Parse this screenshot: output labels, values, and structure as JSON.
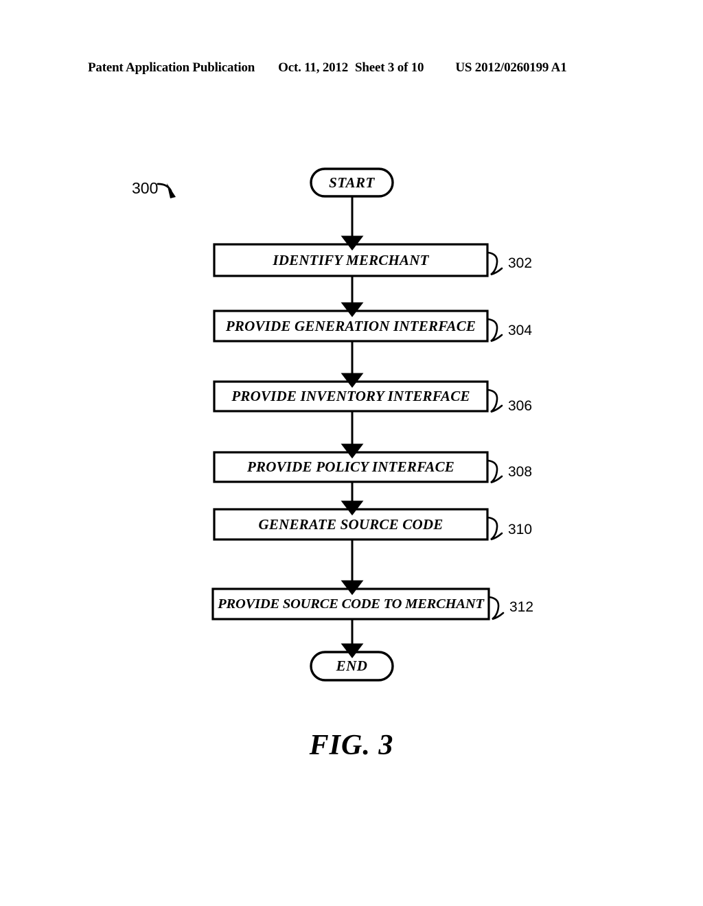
{
  "header": {
    "publication": "Patent Application Publication",
    "date": "Oct. 11, 2012",
    "sheet": "Sheet 3 of 10",
    "document_number": "US 2012/0260199 A1"
  },
  "figure": {
    "caption": "FIG. 3",
    "diagram_reference": "300",
    "start_label": "START",
    "end_label": "END",
    "steps": [
      {
        "label": "IDENTIFY MERCHANT",
        "ref": "302"
      },
      {
        "label": "PROVIDE GENERATION INTERFACE",
        "ref": "304"
      },
      {
        "label": "PROVIDE INVENTORY INTERFACE",
        "ref": "306"
      },
      {
        "label": "PROVIDE POLICY INTERFACE",
        "ref": "308"
      },
      {
        "label": "GENERATE SOURCE CODE",
        "ref": "310"
      },
      {
        "label": "PROVIDE SOURCE CODE TO MERCHANT",
        "ref": "312"
      }
    ]
  },
  "colors": {
    "ink": "#000000",
    "paper": "#ffffff"
  }
}
